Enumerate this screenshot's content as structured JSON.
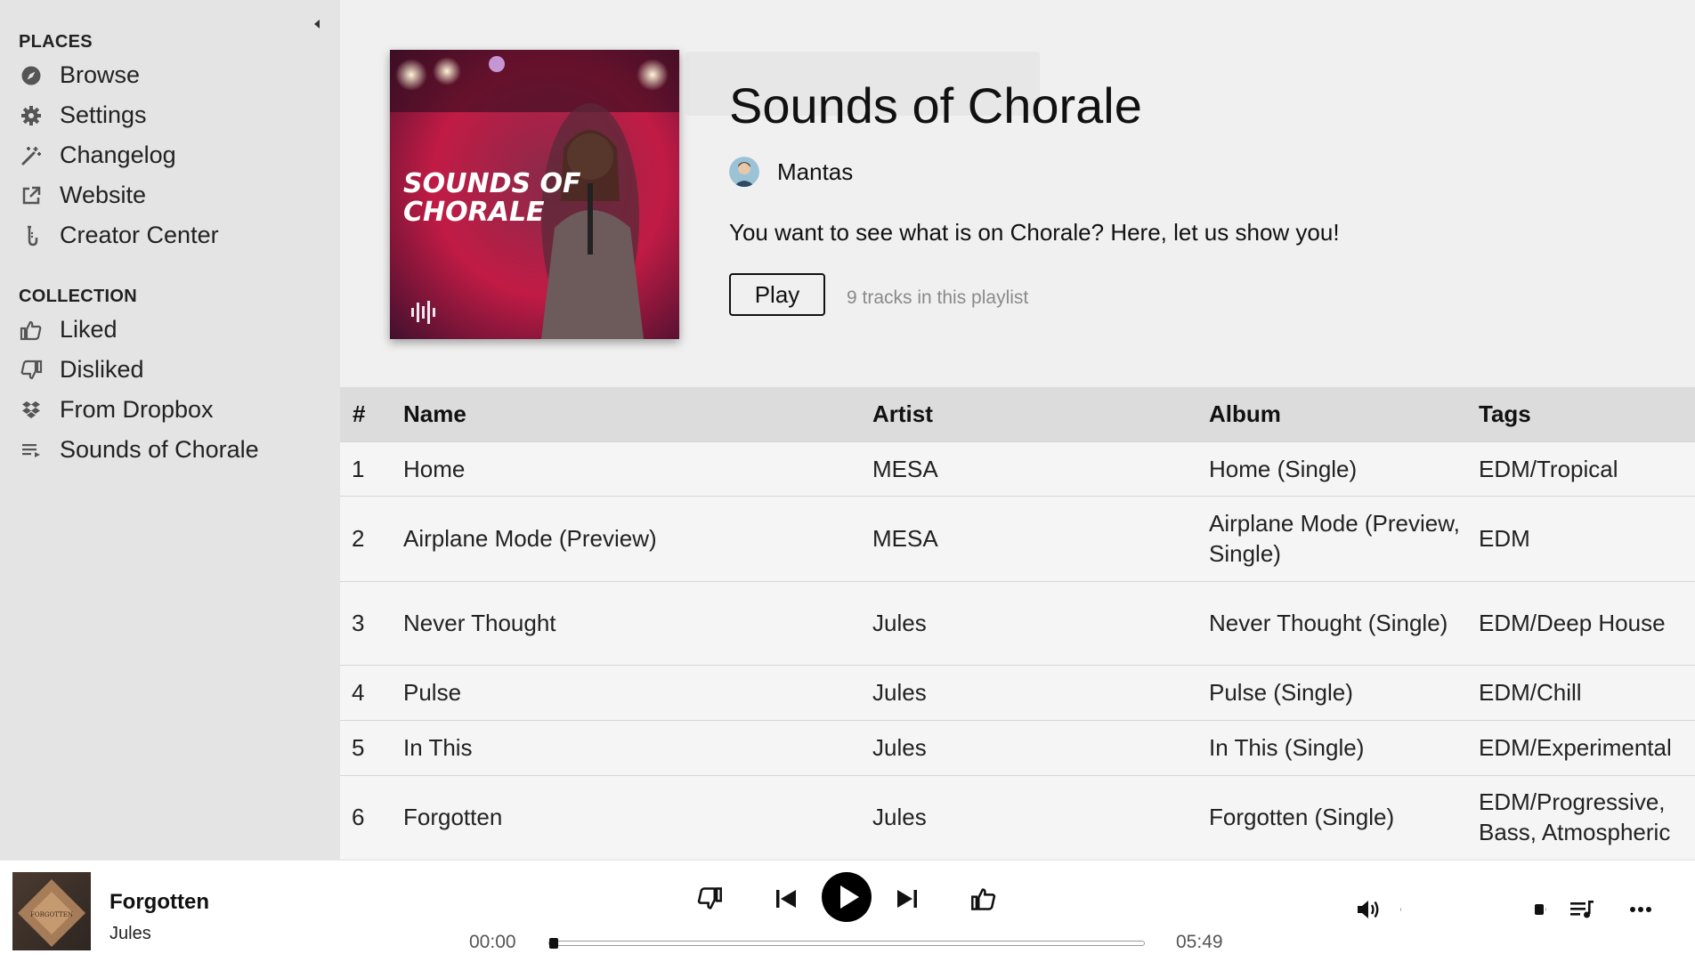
{
  "sidebar": {
    "places_title": "PLACES",
    "places": [
      {
        "label": "Browse",
        "icon": "compass-icon"
      },
      {
        "label": "Settings",
        "icon": "gear-icon"
      },
      {
        "label": "Changelog",
        "icon": "magic-wand-icon"
      },
      {
        "label": "Website",
        "icon": "external-link-icon"
      },
      {
        "label": "Creator Center",
        "icon": "saxophone-icon"
      }
    ],
    "collection_title": "COLLECTION",
    "collection": [
      {
        "label": "Liked",
        "icon": "thumbs-up-icon"
      },
      {
        "label": "Disliked",
        "icon": "thumbs-down-icon"
      },
      {
        "label": "From Dropbox",
        "icon": "dropbox-icon"
      },
      {
        "label": "Sounds of Chorale",
        "icon": "playlist-icon"
      }
    ]
  },
  "playlist": {
    "title": "Sounds of Chorale",
    "cover_text_line1": "SOUNDS OF",
    "cover_text_line2": "CHORALE",
    "owner": "Mantas",
    "description": "You want to see what is on Chorale? Here, let us show you!",
    "play_label": "Play",
    "track_count": "9 tracks in this playlist"
  },
  "table": {
    "headers": {
      "num": "#",
      "name": "Name",
      "artist": "Artist",
      "album": "Album",
      "tags": "Tags"
    },
    "rows": [
      {
        "num": "1",
        "name": "Home",
        "artist": "MESA",
        "album": "Home (Single)",
        "tags": "EDM/Tropical"
      },
      {
        "num": "2",
        "name": "Airplane Mode (Preview)",
        "artist": "MESA",
        "album": "Airplane Mode (Preview, Single)",
        "tags": "EDM"
      },
      {
        "num": "3",
        "name": "Never Thought",
        "artist": "Jules",
        "album": "Never Thought (Single)",
        "tags": "EDM/Deep House"
      },
      {
        "num": "4",
        "name": "Pulse",
        "artist": "Jules",
        "album": "Pulse (Single)",
        "tags": "EDM/Chill"
      },
      {
        "num": "5",
        "name": "In This",
        "artist": "Jules",
        "album": "In This (Single)",
        "tags": "EDM/Experimental"
      },
      {
        "num": "6",
        "name": "Forgotten",
        "artist": "Jules",
        "album": "Forgotten (Single)",
        "tags": "EDM/Progressive, Bass, Atmospheric"
      }
    ]
  },
  "player": {
    "title": "Forgotten",
    "artist": "Jules",
    "art_text": "FORGOTTEN",
    "elapsed": "00:00",
    "duration": "05:49",
    "progress_fraction": 0.0,
    "volume_fraction": 1.0
  },
  "colors": {
    "sidebar_bg": "#e4e4e4",
    "main_bg": "#f0f0f0",
    "header_row_bg": "#dcdcdc",
    "row_bg": "#f5f5f5",
    "player_bg": "#ffffff"
  }
}
